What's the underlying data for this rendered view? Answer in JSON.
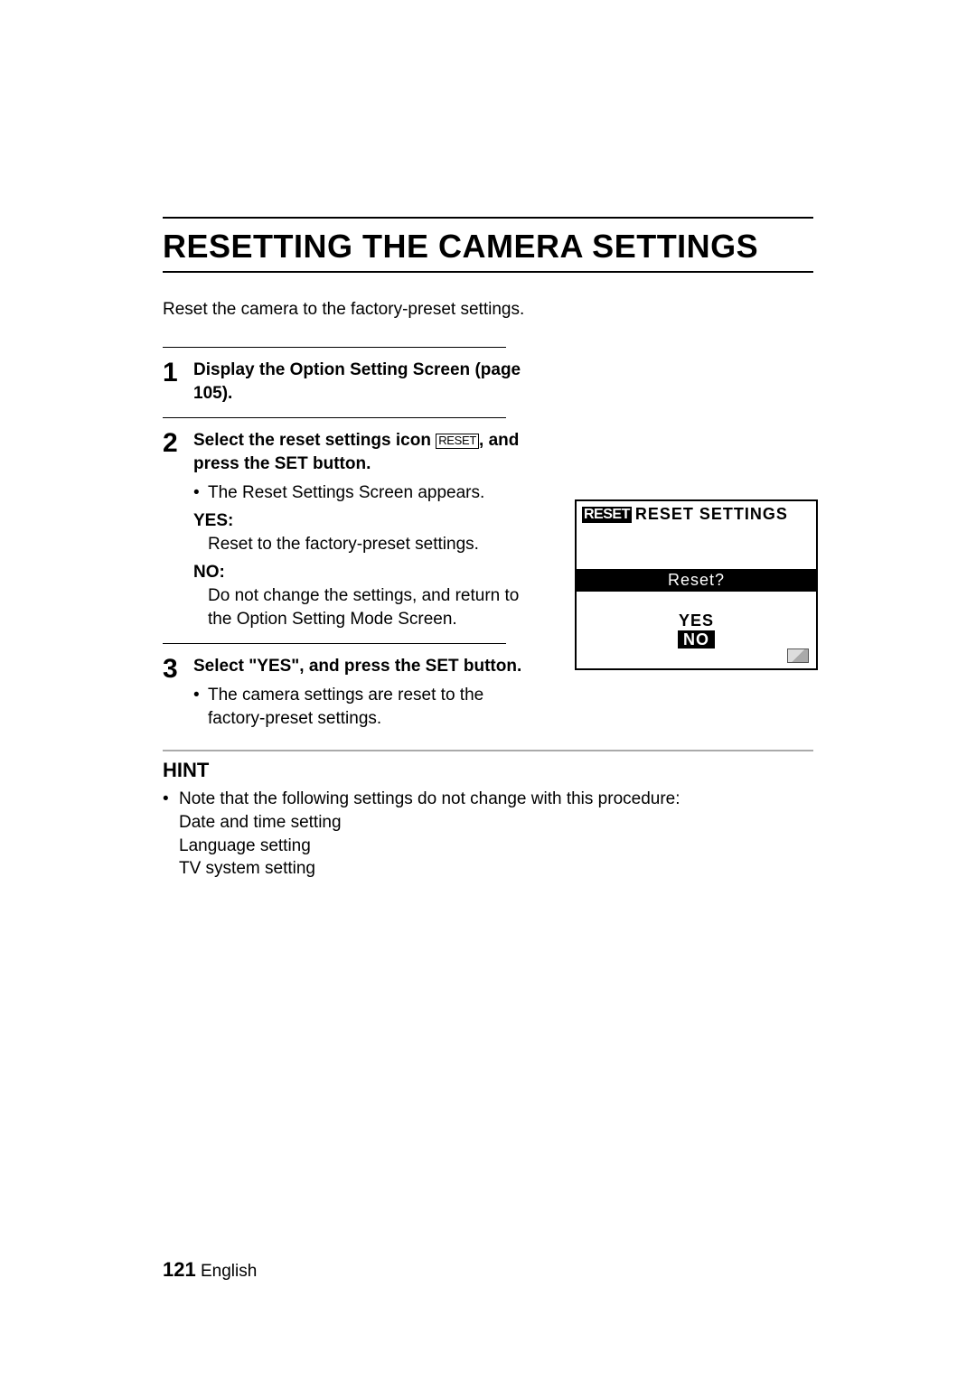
{
  "title": "RESETTING THE CAMERA SETTINGS",
  "intro": "Reset the camera to the factory-preset settings.",
  "steps": [
    {
      "num": "1",
      "headline_a": "Display the Option Setting Screen",
      "headline_b": "page 105).",
      "open_paren": "("
    },
    {
      "num": "2",
      "headline_a": "Select the reset settings icon ",
      "icon_text": "RESET",
      "headline_b": ", and press the SET button.",
      "bullet1": "The Reset Settings Screen appears.",
      "yes_label": "YES:",
      "yes_text": "Reset to the factory-preset settings.",
      "no_label": "NO:",
      "no_text": "Do not change the settings, and return to the Option Setting Mode Screen."
    },
    {
      "num": "3",
      "headline_a": "Select \"YES\", and press the SET button.",
      "bullet1": "The camera settings are reset to the factory-preset settings."
    }
  ],
  "screen": {
    "header_label": "RESET",
    "header_title": "RESET SETTINGS",
    "question": "Reset?",
    "yes": "YES",
    "no": "NO"
  },
  "hint": {
    "title": "HINT",
    "note": "Note that the following settings do not change with this procedure:",
    "items": [
      "Date and time setting",
      "Language setting",
      "TV system setting"
    ]
  },
  "footer": {
    "page_num": "121",
    "lang": "English"
  }
}
